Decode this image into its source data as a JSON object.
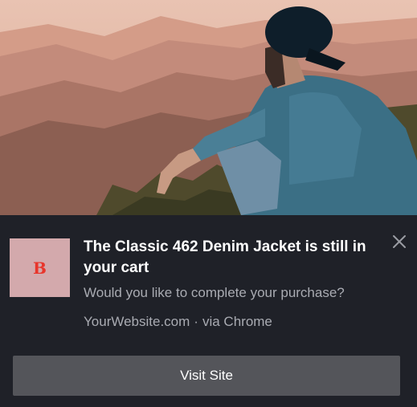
{
  "notification": {
    "logo_letter": "B",
    "title": "The Classic 462 Denim Jacket is still in your cart",
    "message": "Would you like to complete your purchase?",
    "site": "YourWebsite.com",
    "separator": "·",
    "browser": "via Chrome",
    "action_label": "Visit Site"
  },
  "icons": {
    "close": "close-icon",
    "hero": "hero-image"
  },
  "colors": {
    "panel_bg": "#1f2128",
    "logo_bg": "#d3a9ac",
    "logo_letter": "#e8352b",
    "button_bg": "#54555a",
    "title": "#ffffff",
    "secondary_text": "#a9abb2"
  }
}
